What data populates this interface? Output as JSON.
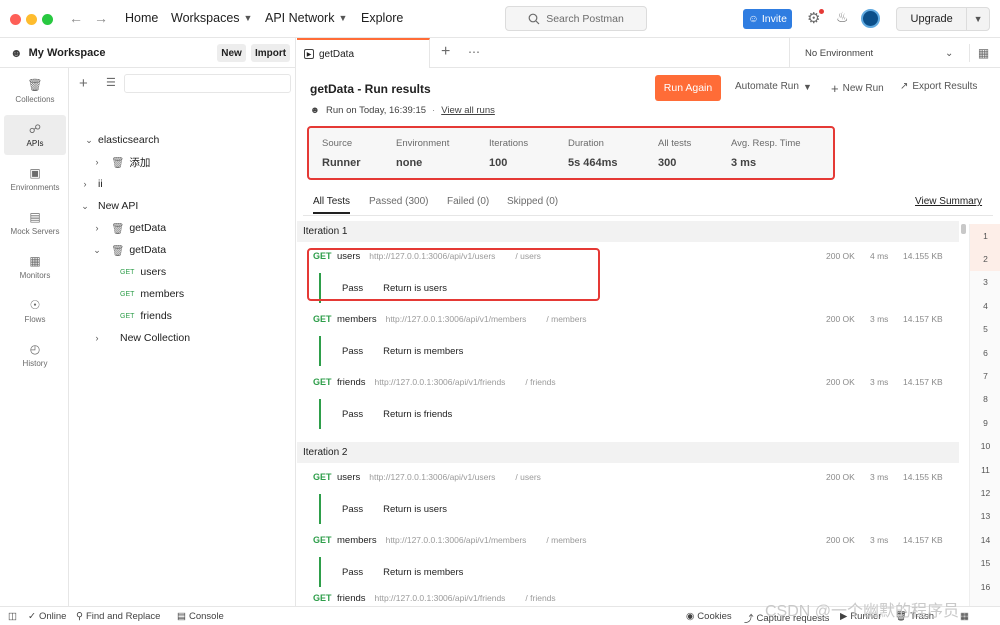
{
  "topbar": {
    "nav": [
      "Home",
      "Workspaces",
      "API Network",
      "Explore"
    ],
    "search_placeholder": "Search Postman",
    "invite": "Invite",
    "upgrade": "Upgrade"
  },
  "sidebar": {
    "workspace": "My Workspace",
    "new": "New",
    "import": "Import",
    "rail": [
      "Collections",
      "APIs",
      "Environments",
      "Mock Servers",
      "Monitors",
      "Flows",
      "History"
    ],
    "tree": [
      {
        "label": "elasticsearch"
      },
      {
        "label": "添加"
      },
      {
        "label": "ii"
      },
      {
        "label": "New API"
      },
      {
        "label": "getData"
      },
      {
        "label": "getData"
      },
      {
        "method": "GET",
        "label": "users"
      },
      {
        "method": "GET",
        "label": "members"
      },
      {
        "method": "GET",
        "label": "friends"
      },
      {
        "label": "New Collection"
      }
    ]
  },
  "tabs": {
    "active": "getData",
    "environment": "No Environment"
  },
  "run": {
    "title": "getData - Run results",
    "subtitle": "Run on Today, 16:39:15",
    "view_all": "View all runs",
    "run_again": "Run Again",
    "automate": "Automate Run",
    "new_run": "New Run",
    "export": "Export Results",
    "summary": [
      {
        "label": "Source",
        "value": "Runner"
      },
      {
        "label": "Environment",
        "value": "none"
      },
      {
        "label": "Iterations",
        "value": "100"
      },
      {
        "label": "Duration",
        "value": "5s 464ms"
      },
      {
        "label": "All tests",
        "value": "300"
      },
      {
        "label": "Avg. Resp. Time",
        "value": "3 ms"
      }
    ],
    "result_tabs": [
      "All Tests",
      "Passed (300)",
      "Failed (0)",
      "Skipped (0)"
    ],
    "view_summary": "View Summary",
    "iter1": "Iteration 1",
    "iter2": "Iteration 2",
    "requests": [
      {
        "method": "GET",
        "name": "users",
        "url": "http://127.0.0.1:3006/api/v1/users",
        "path": "/ users",
        "status": "200 OK",
        "time": "4 ms",
        "size": "14.155 KB",
        "result": "Pass",
        "test": "Return is users"
      },
      {
        "method": "GET",
        "name": "members",
        "url": "http://127.0.0.1:3006/api/v1/members",
        "path": "/ members",
        "status": "200 OK",
        "time": "3 ms",
        "size": "14.157 KB",
        "result": "Pass",
        "test": "Return is members"
      },
      {
        "method": "GET",
        "name": "friends",
        "url": "http://127.0.0.1:3006/api/v1/friends",
        "path": "/ friends",
        "status": "200 OK",
        "time": "3 ms",
        "size": "14.157 KB",
        "result": "Pass",
        "test": "Return is friends"
      },
      {
        "method": "GET",
        "name": "users",
        "url": "http://127.0.0.1:3006/api/v1/users",
        "path": "/ users",
        "status": "200 OK",
        "time": "3 ms",
        "size": "14.155 KB",
        "result": "Pass",
        "test": "Return is users"
      },
      {
        "method": "GET",
        "name": "members",
        "url": "http://127.0.0.1:3006/api/v1/members",
        "path": "/ members",
        "status": "200 OK",
        "time": "3 ms",
        "size": "14.157 KB",
        "result": "Pass",
        "test": "Return is members"
      },
      {
        "method": "GET",
        "name": "friends",
        "url": "http://127.0.0.1:3006/api/v1/friends",
        "path": "/ friends"
      }
    ],
    "line_numbers": [
      "1",
      "2",
      "3",
      "4",
      "5",
      "6",
      "7",
      "8",
      "9",
      "10",
      "11",
      "12",
      "13",
      "14",
      "15",
      "16"
    ]
  },
  "status": {
    "online": "Online",
    "find": "Find and Replace",
    "console": "Console",
    "cookies": "Cookies",
    "capture": "Capture requests",
    "runner": "Runner",
    "trash": "Trash"
  },
  "watermark": "CSDN @一个幽默的程序员"
}
